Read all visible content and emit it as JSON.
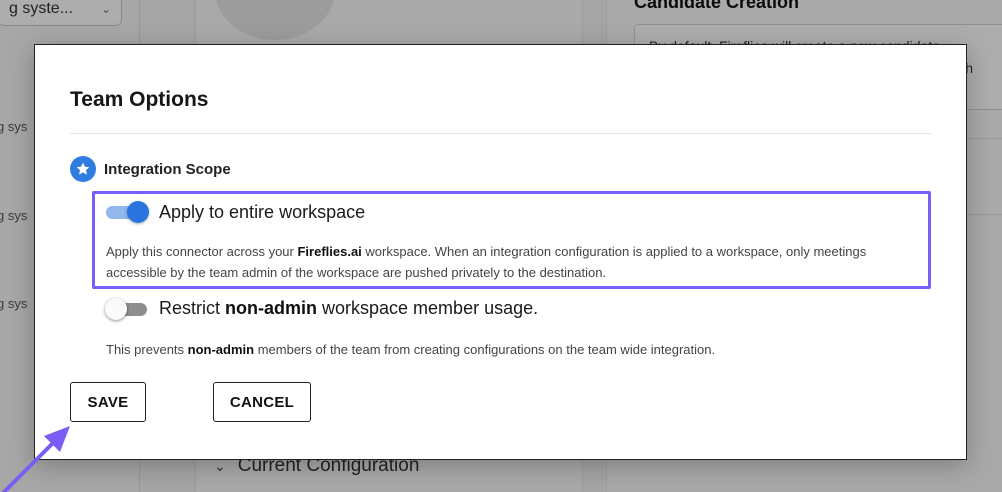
{
  "background": {
    "select_value": "g syste...",
    "row_labels": [
      "g sys",
      "g sys",
      "g sys"
    ],
    "right_title": "Candidate Creation",
    "right_box_line1": "By default, Fireflies will create a new candidate",
    "right_box_line2": "witch",
    "config_label": "Current Configuration"
  },
  "modal": {
    "title": "Team Options",
    "section_label": "Integration Scope",
    "options": [
      {
        "label": "Apply to entire workspace",
        "enabled": true,
        "desc_pre": "Apply this connector across your ",
        "desc_bold": "Fireflies.ai",
        "desc_post": " workspace. When an integration configuration is applied to a workspace, only meetings accessible by the team admin of the workspace are pushed privately to the destination."
      },
      {
        "label_pre": "Restrict ",
        "label_bold": "non-admin",
        "label_post": " workspace member usage.",
        "enabled": false,
        "desc_pre": "This prevents ",
        "desc_bold": "non-admin",
        "desc_post": " members of the team from creating configurations on the team wide integration."
      }
    ],
    "save_label": "SAVE",
    "cancel_label": "CANCEL"
  },
  "colors": {
    "accent": "#2b74de",
    "highlight": "#7b5cf5",
    "star_badge": "#2f7de1"
  },
  "icons": {
    "section": "star-icon",
    "dropdown": "chevron-down-icon",
    "pointer": "arrow-annotation-icon"
  }
}
